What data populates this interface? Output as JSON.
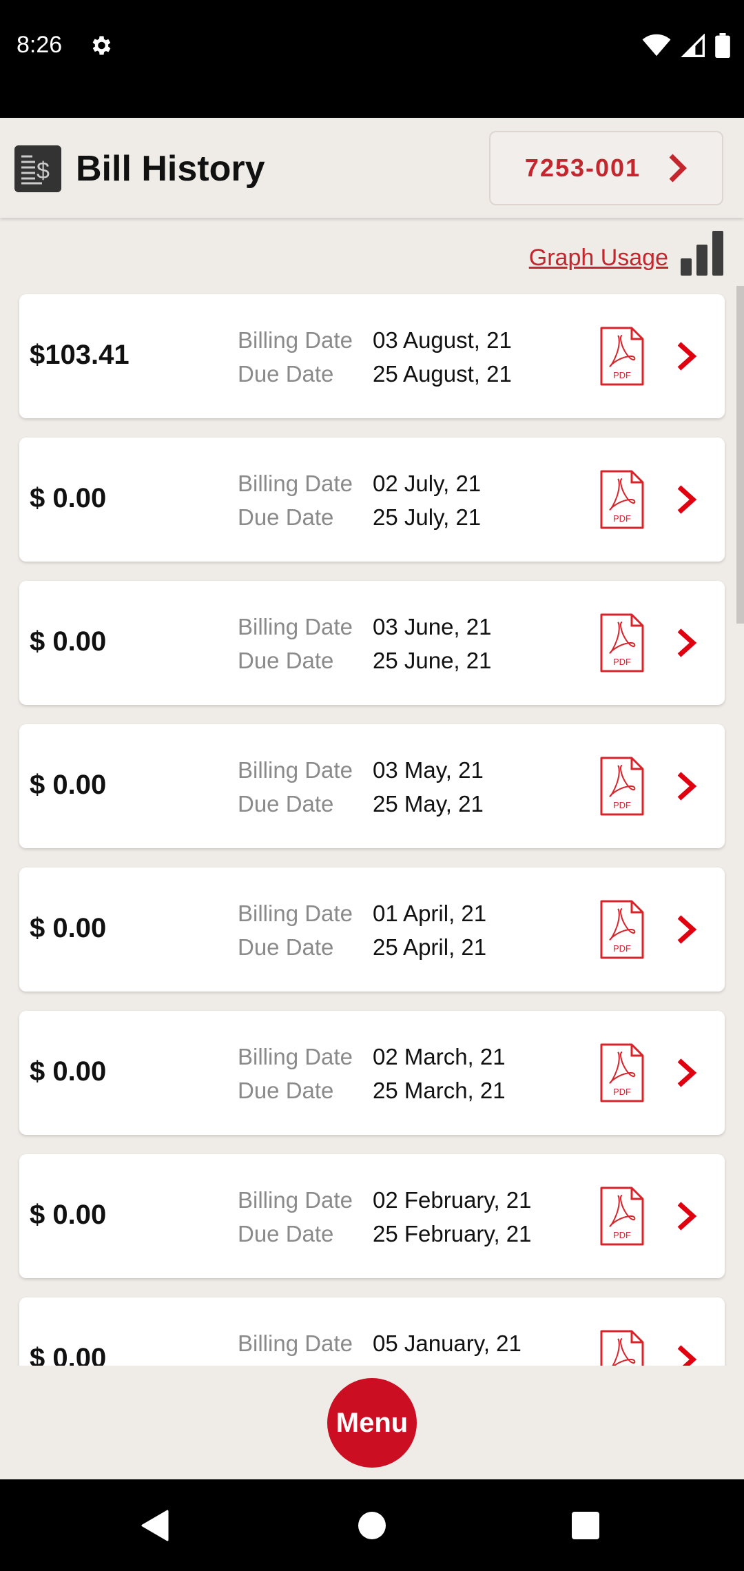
{
  "status_bar": {
    "time": "8:26",
    "icons": [
      "gear-icon",
      "wifi-icon",
      "signal-icon",
      "battery-icon"
    ]
  },
  "header": {
    "title": "Bill History",
    "icon": "bill-dollar-icon",
    "account_number": "7253-001"
  },
  "graph_usage": {
    "label": "Graph Usage",
    "icon": "bar-chart-icon"
  },
  "labels": {
    "billing_date": "Billing Date",
    "due_date": "Due Date"
  },
  "bills": [
    {
      "amount": "$103.41",
      "billing_date": "03 August, 21",
      "due_date": "25 August, 21"
    },
    {
      "amount": "$ 0.00",
      "billing_date": "02 July, 21",
      "due_date": "25 July, 21"
    },
    {
      "amount": "$ 0.00",
      "billing_date": "03 June, 21",
      "due_date": "25 June, 21"
    },
    {
      "amount": "$ 0.00",
      "billing_date": "03 May, 21",
      "due_date": "25 May, 21"
    },
    {
      "amount": "$ 0.00",
      "billing_date": "01 April, 21",
      "due_date": "25 April, 21"
    },
    {
      "amount": "$ 0.00",
      "billing_date": "02 March, 21",
      "due_date": "25 March, 21"
    },
    {
      "amount": "$ 0.00",
      "billing_date": "02 February, 21",
      "due_date": "25 February, 21"
    },
    {
      "amount": "$ 0.00",
      "billing_date": "05 January, 21",
      "due_date": ""
    }
  ],
  "pdf_label": "PDF",
  "menu_label": "Menu",
  "colors": {
    "accent": "#c4262e",
    "menu": "#cc0e23",
    "chevron": "#e0000f",
    "background": "#efebe7"
  }
}
